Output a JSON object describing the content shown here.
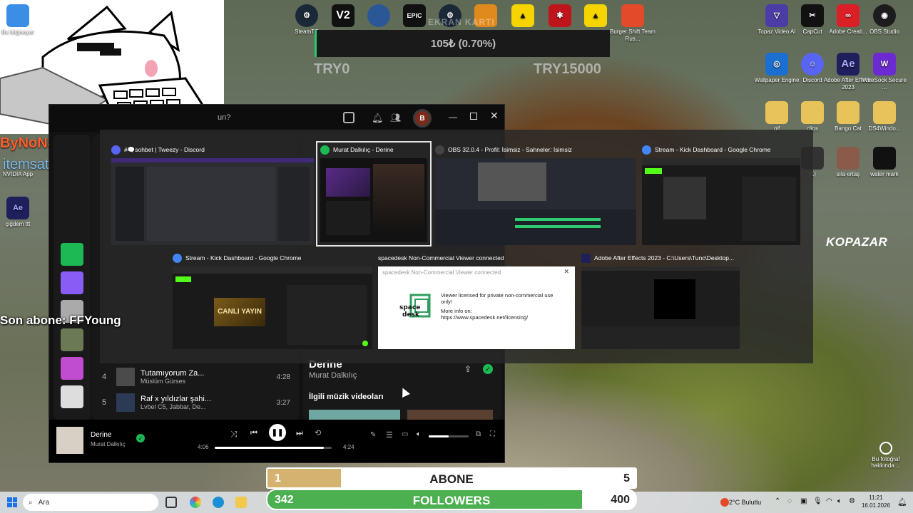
{
  "desktop_icons_left": [
    {
      "label": "Bu bilgisayar",
      "icon": "computer-icon"
    },
    {
      "label": "NVIDIA App",
      "icon": "nvidia-icon"
    },
    {
      "label": "çiğdem ttt",
      "icon": "after-effects-file-icon",
      "glyph": "Ae"
    }
  ],
  "desktop_icons_top": [
    {
      "label": "SteamTC",
      "icon": "steam-icon",
      "color": "#1b2838"
    },
    {
      "label": "V2",
      "icon": "v2-icon",
      "color": "#111111",
      "glyph": "V2"
    },
    {
      "label": "",
      "icon": "app-icon",
      "color": "#2b5797"
    },
    {
      "label": "",
      "icon": "epic-games-icon",
      "color": "#111111",
      "glyph": "EPIC"
    },
    {
      "label": "",
      "icon": "steam-icon",
      "color": "#1b2838"
    },
    {
      "label": "",
      "icon": "cs-icon",
      "color": "#e08a1e"
    },
    {
      "label": "",
      "icon": "game-icon",
      "color": "#f6d400"
    },
    {
      "label": "",
      "icon": "spiderman-icon",
      "color": "#c0141d"
    },
    {
      "label": "",
      "icon": "game-icon",
      "color": "#f6d400"
    },
    {
      "label": "Burger Shift Team Rus...",
      "icon": "burger-shift-icon",
      "color": "#e24a2a"
    }
  ],
  "desktop_icons_right": [
    {
      "label": "Topaz Video AI",
      "icon": "topaz-icon",
      "color": "#4b3ca6"
    },
    {
      "label": "CapCut",
      "icon": "capcut-icon",
      "color": "#111111"
    },
    {
      "label": "Adobe Creati...",
      "icon": "creative-cloud-icon",
      "color": "#da1f26"
    },
    {
      "label": "OBS Studio",
      "icon": "obs-icon",
      "color": "#1c1c1c"
    },
    {
      "label": "Wallpaper Engine",
      "icon": "wallpaper-engine-icon",
      "color": "#1b6fd1"
    },
    {
      "label": "Discord",
      "icon": "discord-icon",
      "color": "#5865f2"
    },
    {
      "label": "Adobe After Effects 2023",
      "icon": "after-effects-icon",
      "color": "#1f1f5c",
      "glyph": "Ae"
    },
    {
      "label": "WireSock Secure ...",
      "icon": "wiresock-icon",
      "color": "#6b2bd1"
    },
    {
      "label": "gif",
      "icon": "folder-icon",
      "color": "#e8c35a"
    },
    {
      "label": "clips",
      "icon": "folder-icon",
      "color": "#e8c35a"
    },
    {
      "label": "Bango Cat",
      "icon": "folder-icon",
      "color": "#e8c35a"
    },
    {
      "label": "DS4Windo...",
      "icon": "folder-icon",
      "color": "#e8c35a"
    },
    {
      "label": "(1)",
      "icon": "image-file-icon",
      "color": "#333333"
    },
    {
      "label": "sıla ertaş",
      "icon": "image-file-icon",
      "color": "#8a5a4a"
    },
    {
      "label": "water mark",
      "icon": "image-file-icon",
      "color": "#111111"
    }
  ],
  "overlay": {
    "ekran_title": "EKRAN KARTI",
    "ekran_value": "105₺ (0.70%)",
    "try_left": "TRY0",
    "try_right": "TRY15000",
    "son_abone": "Son abone: FFYoung",
    "watermark_bynoname": "ByNoName",
    "watermark_itemsatis": "itemsatış",
    "kopazar": "KOPAZAR",
    "bu_fotograf": "Bu fotoğraf hakkında ..."
  },
  "spotify": {
    "search_placeholder": "un?",
    "avatar_letter": "B",
    "tracks": [
      {
        "num": "4",
        "title": "Tutamıyorum Za...",
        "artist": "Müslüm Gürses",
        "duration": "4:28"
      },
      {
        "num": "5",
        "title": "Raf x yıldızlar şahi...",
        "artist": "Lvbel C5, Jabbar, De...",
        "duration": "3:27"
      }
    ],
    "now_playing_title_right": "Derine",
    "now_playing_artist_right": "Murat Dalkılıç",
    "related_videos": "İlgili müzik videoları",
    "player": {
      "title": "Derine",
      "artist": "Murat Dalkılıç",
      "elapsed": "4:06",
      "total": "4:24",
      "progress": 0.93,
      "volume": 0.5
    }
  },
  "switcher": {
    "windows": [
      {
        "title": "#🗨️sohbet | Tweezy - Discord",
        "icon": "discord-icon",
        "color": "#5865f2"
      },
      {
        "title": "Murat Dalkılıç - Derine",
        "icon": "spotify-icon",
        "color": "#1db954",
        "selected": true
      },
      {
        "title": "OBS 32.0.4 - Profil: İsimsiz - Sahneler: İsimsiz",
        "icon": "obs-icon",
        "color": "#444444"
      },
      {
        "title": "Stream - Kick Dashboard - Google Chrome",
        "icon": "chrome-icon",
        "color": "#4285f4"
      },
      {
        "title": "Stream - Kick Dashboard - Google Chrome",
        "icon": "chrome-icon",
        "color": "#4285f4"
      },
      {
        "title": "spacedesk Non-Commercial Viewer connected",
        "icon": "spacedesk-icon",
        "color": "#2e9e5e"
      },
      {
        "title": "Adobe After Effects 2023 - C:\\Users\\Tunc\\Desktop...",
        "icon": "after-effects-icon",
        "color": "#1f1f5c"
      }
    ],
    "spacedesk_dialog": {
      "title": "spacedesk Non-Commercial Viewer connected",
      "line1": "Viewer licensed for private non-commercial use only!",
      "line2": "More info on:",
      "line3": "https://www.spacedesk.net/licensing/",
      "logo": "space desk"
    },
    "kick_canli": "CANLI YAYIN"
  },
  "bars": {
    "abone": {
      "left": "1",
      "label": "ABONE",
      "right": "5",
      "progress": 0.2,
      "fill_color": "#d3b36f"
    },
    "followers": {
      "left": "342",
      "label": "FOLLOWERS",
      "right": "400",
      "progress": 0.855,
      "fill_color": "#4caf50"
    }
  },
  "taskbar": {
    "search_placeholder": "Ara",
    "weather": "2°C  Bulutlu",
    "time": "11:21",
    "date": "16.01.2026"
  }
}
